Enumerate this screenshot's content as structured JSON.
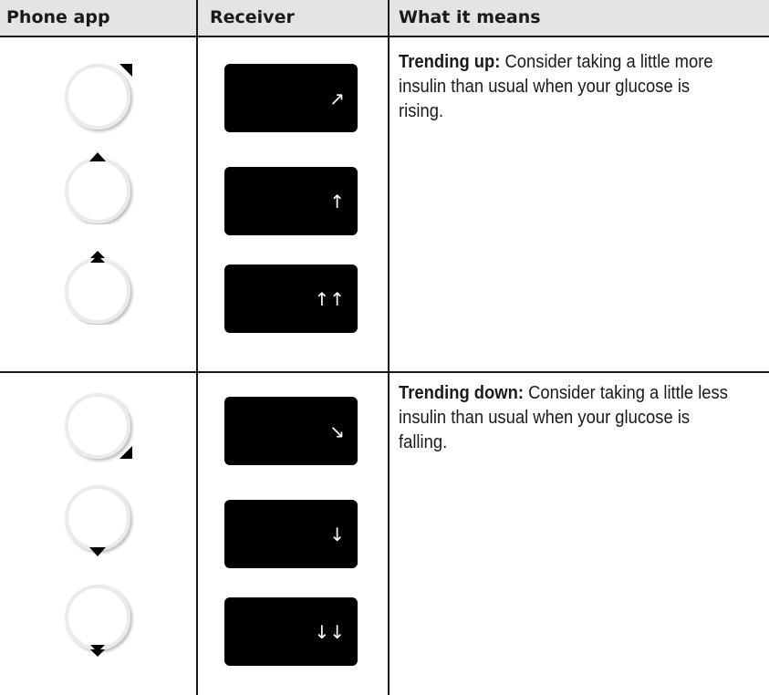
{
  "header": {
    "phone_app": "Phone app",
    "receiver": "Receiver",
    "what_it_means": "What it means"
  },
  "rows": [
    {
      "group": "up",
      "lead": "Trending up:",
      "text": " Consider taking a little more insulin than usual when your glucose is rising.",
      "items": [
        {
          "phone_icon": "circle-arrow-diagonal-up-icon",
          "receiver_arrow": "↗"
        },
        {
          "phone_icon": "circle-arrow-up-icon",
          "receiver_arrow": "↑"
        },
        {
          "phone_icon": "circle-double-arrow-up-icon",
          "receiver_arrow": "↑↑"
        }
      ]
    },
    {
      "group": "down",
      "lead": "Trending down:",
      "text": " Consider taking a little less insulin than usual when your glucose is falling.",
      "items": [
        {
          "phone_icon": "circle-arrow-diagonal-down-icon",
          "receiver_arrow": "↘"
        },
        {
          "phone_icon": "circle-arrow-down-icon",
          "receiver_arrow": "↓"
        },
        {
          "phone_icon": "circle-double-arrow-down-icon",
          "receiver_arrow": "↓↓"
        }
      ]
    }
  ],
  "colors": {
    "header_bg": "#e4e4e4",
    "rule": "#1a1a1a",
    "receiver_bg": "#000000",
    "arrow": "#ffffff"
  }
}
